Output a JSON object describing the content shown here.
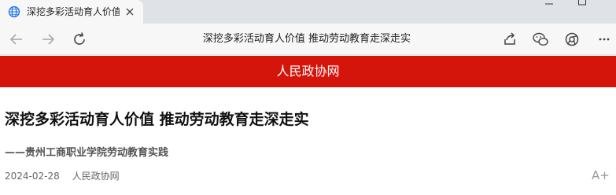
{
  "browser": {
    "tab_title": "深挖多彩活动育人价值",
    "page_title": "深挖多彩活动育人价值 推动劳动教育走深走实"
  },
  "site": {
    "name": "人民政协网"
  },
  "article": {
    "headline": "深挖多彩活动育人价值 推动劳动教育走深走实",
    "subheadline": "——贵州工商职业学院劳动教育实践",
    "date": "2024-02-28",
    "source": "人民政协网",
    "font_size_control": "A+"
  },
  "colors": {
    "header_red": "#d4150b",
    "tabstrip_bg": "#dfe3e8",
    "toolbar_bg": "#f7f7f7"
  },
  "icons": [
    "globe-icon",
    "close-icon",
    "minimize-icon",
    "maximize-icon",
    "back-arrow-icon",
    "forward-arrow-icon",
    "reload-icon",
    "share-icon",
    "wechat-icon",
    "browser-icon",
    "more-icon"
  ]
}
